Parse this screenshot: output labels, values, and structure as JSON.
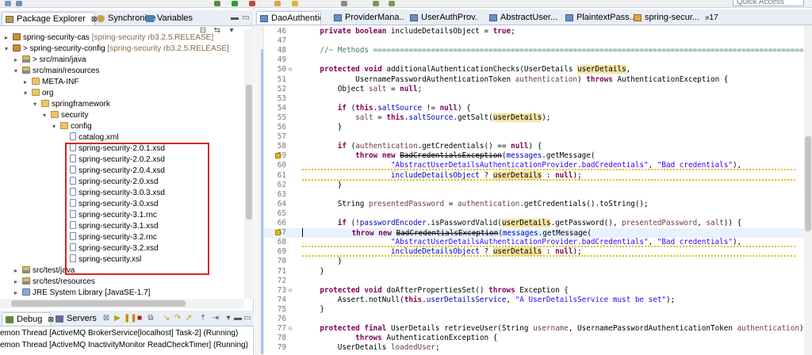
{
  "toolbar": {
    "quick_access_placeholder": "Quick Access"
  },
  "left_panel": {
    "tabs": [
      {
        "label": "Package Explorer",
        "close": "⊠"
      },
      {
        "label": "Synchronize"
      },
      {
        "label": "Variables"
      }
    ],
    "tree": [
      {
        "label": "spring-security-cas",
        "decor": " [spring-security rb3.2.5.RELEASE]",
        "icon": "project-icon",
        "twisty": "▸",
        "level": 0
      },
      {
        "label": "> spring-security-config",
        "decor": " [spring-security rb3.2.5.RELEASE]",
        "icon": "project-icon",
        "twisty": "▾",
        "level": 0
      },
      {
        "label": "> src/main/java",
        "decor": "",
        "icon": "source-folder-icon",
        "twisty": "▸",
        "level": 1
      },
      {
        "label": "src/main/resources",
        "decor": "",
        "icon": "source-folder-icon",
        "twisty": "▾",
        "level": 1
      },
      {
        "label": "META-INF",
        "decor": "",
        "icon": "folder-icon",
        "twisty": "▸",
        "level": 2
      },
      {
        "label": "org",
        "decor": "",
        "icon": "folder-icon",
        "twisty": "▾",
        "level": 2
      },
      {
        "label": "springframework",
        "decor": "",
        "icon": "folder-icon",
        "twisty": "▾",
        "level": 3
      },
      {
        "label": "security",
        "decor": "",
        "icon": "folder-icon",
        "twisty": "▾",
        "level": 4
      },
      {
        "label": "config",
        "decor": "",
        "icon": "folder-icon",
        "twisty": "▾",
        "level": 5
      },
      {
        "label": "catalog.xml",
        "decor": "",
        "icon": "file-icon",
        "twisty": "",
        "level": 6
      },
      {
        "label": "spring-security-2.0.1.xsd",
        "decor": "",
        "icon": "file-icon",
        "twisty": "",
        "level": 6
      },
      {
        "label": "spring-security-2.0.2.xsd",
        "decor": "",
        "icon": "file-icon",
        "twisty": "",
        "level": 6
      },
      {
        "label": "spring-security-2.0.4.xsd",
        "decor": "",
        "icon": "file-icon",
        "twisty": "",
        "level": 6
      },
      {
        "label": "spring-security-2.0.xsd",
        "decor": "",
        "icon": "file-icon",
        "twisty": "",
        "level": 6
      },
      {
        "label": "spring-security-3.0.3.xsd",
        "decor": "",
        "icon": "file-icon",
        "twisty": "",
        "level": 6
      },
      {
        "label": "spring-security-3.0.xsd",
        "decor": "",
        "icon": "file-icon",
        "twisty": "",
        "level": 6
      },
      {
        "label": "spring-security-3.1.rnc",
        "decor": "",
        "icon": "file-icon",
        "twisty": "",
        "level": 6
      },
      {
        "label": "spring-security-3.1.xsd",
        "decor": "",
        "icon": "file-icon",
        "twisty": "",
        "level": 6
      },
      {
        "label": "spring-security-3.2.rnc",
        "decor": "",
        "icon": "file-icon",
        "twisty": "",
        "level": 6
      },
      {
        "label": "spring-security-3.2.xsd",
        "decor": "",
        "icon": "file-icon",
        "twisty": "",
        "level": 6
      },
      {
        "label": "spring-security.xsl",
        "decor": "",
        "icon": "file-icon",
        "twisty": "",
        "level": 6
      },
      {
        "label": "src/test/java",
        "decor": "",
        "icon": "source-folder-icon",
        "twisty": "▸",
        "level": 1
      },
      {
        "label": "src/test/resources",
        "decor": "",
        "icon": "source-folder-icon",
        "twisty": "▸",
        "level": 1
      },
      {
        "label": "JRE System Library [JavaSE-1.7]",
        "decor": "",
        "icon": "library-icon",
        "twisty": "▸",
        "level": 1
      }
    ]
  },
  "bottom_panel": {
    "tabs": [
      {
        "label": "Debug",
        "close": "⊠"
      },
      {
        "label": "Servers"
      }
    ],
    "lines": [
      "emon Thread [ActiveMQ BrokerService[localhost] Task-2] (Running)",
      "emon Thread [ActiveMQ InactivityMonitor ReadCheckTimer] (Running)"
    ]
  },
  "editor": {
    "tabs": [
      {
        "label": "DaoAuthentic",
        "active": true
      },
      {
        "label": "ProviderMana..."
      },
      {
        "label": "UserAuthProv..."
      },
      {
        "label": "AbstractUser..."
      },
      {
        "label": "PlaintextPass..."
      },
      {
        "label": "spring-secur..."
      }
    ],
    "overflow_count": "»17",
    "lines": [
      {
        "n": "46",
        "segs": [
          [
            "t",
            "    "
          ],
          [
            "kw",
            "private boolean"
          ],
          [
            "t",
            " includeDetailsObject = "
          ],
          [
            "kw",
            "true"
          ],
          [
            "t",
            ";"
          ]
        ]
      },
      {
        "n": "47",
        "segs": []
      },
      {
        "n": "48",
        "segs": [
          [
            "t",
            "    "
          ],
          [
            "cm",
            "//~ Methods ========================================================================================================"
          ]
        ]
      },
      {
        "n": "49",
        "segs": []
      },
      {
        "n": "50",
        "fold": "⊖",
        "segs": [
          [
            "t",
            "    "
          ],
          [
            "kw",
            "protected void"
          ],
          [
            "t",
            " additionalAuthenticationChecks(UserDetails "
          ],
          [
            "occ",
            "userDetails"
          ],
          [
            "t",
            ","
          ]
        ]
      },
      {
        "n": "51",
        "segs": [
          [
            "t",
            "            UsernamePasswordAuthenticationToken "
          ],
          [
            "prm",
            "authentication"
          ],
          [
            "t",
            ") "
          ],
          [
            "kw",
            "throws"
          ],
          [
            "t",
            " AuthenticationException {"
          ]
        ]
      },
      {
        "n": "52",
        "segs": [
          [
            "t",
            "        Object "
          ],
          [
            "prm",
            "salt"
          ],
          [
            "t",
            " = "
          ],
          [
            "kw",
            "null"
          ],
          [
            "t",
            ";"
          ]
        ]
      },
      {
        "n": "53",
        "segs": []
      },
      {
        "n": "54",
        "segs": [
          [
            "t",
            "        "
          ],
          [
            "kw",
            "if"
          ],
          [
            "t",
            " ("
          ],
          [
            "kw",
            "this"
          ],
          [
            "t",
            "."
          ],
          [
            "fld",
            "saltSource"
          ],
          [
            "t",
            " != "
          ],
          [
            "kw",
            "null"
          ],
          [
            "t",
            ") {"
          ]
        ]
      },
      {
        "n": "55",
        "segs": [
          [
            "t",
            "            "
          ],
          [
            "prm",
            "salt"
          ],
          [
            "t",
            " = "
          ],
          [
            "kw",
            "this"
          ],
          [
            "t",
            "."
          ],
          [
            "fld",
            "saltSource"
          ],
          [
            "t",
            ".getSalt("
          ],
          [
            "occ",
            "userDetails"
          ],
          [
            "t",
            ");"
          ]
        ]
      },
      {
        "n": "56",
        "segs": [
          [
            "t",
            "        }"
          ]
        ]
      },
      {
        "n": "57",
        "segs": []
      },
      {
        "n": "58",
        "segs": [
          [
            "t",
            "        "
          ],
          [
            "kw",
            "if"
          ],
          [
            "t",
            " ("
          ],
          [
            "prm",
            "authentication"
          ],
          [
            "t",
            ".getCredentials() == "
          ],
          [
            "kw",
            "null"
          ],
          [
            "t",
            ") {"
          ]
        ]
      },
      {
        "n": "59",
        "marker": "warn",
        "segs": [
          [
            "t",
            "            "
          ],
          [
            "kw",
            "throw new"
          ],
          [
            "t",
            " "
          ],
          [
            "strike",
            "BadCredentialsException"
          ],
          [
            "t",
            "("
          ],
          [
            "fld",
            "messages"
          ],
          [
            "t",
            ".getMessage("
          ]
        ]
      },
      {
        "n": "60",
        "warn": true,
        "segs": [
          [
            "t",
            "                    "
          ],
          [
            "str",
            "\"AbstractUserDetailsAuthenticationProvider.badCredentials\""
          ],
          [
            "t",
            ", "
          ],
          [
            "str",
            "\"Bad credentials\""
          ],
          [
            "t",
            "),"
          ]
        ]
      },
      {
        "n": "61",
        "warn": true,
        "segs": [
          [
            "t",
            "                    "
          ],
          [
            "fld",
            "includeDetailsObject"
          ],
          [
            "t",
            " ? "
          ],
          [
            "occ",
            "userDetails"
          ],
          [
            "t",
            " : "
          ],
          [
            "kw",
            "null"
          ],
          [
            "t",
            ");"
          ]
        ]
      },
      {
        "n": "62",
        "segs": [
          [
            "t",
            "        }"
          ]
        ]
      },
      {
        "n": "63",
        "segs": []
      },
      {
        "n": "64",
        "segs": [
          [
            "t",
            "        String "
          ],
          [
            "prm",
            "presentedPassword"
          ],
          [
            "t",
            " = "
          ],
          [
            "prm",
            "authentication"
          ],
          [
            "t",
            ".getCredentials().toString();"
          ]
        ]
      },
      {
        "n": "65",
        "segs": []
      },
      {
        "n": "66",
        "segs": [
          [
            "t",
            "        "
          ],
          [
            "kw",
            "if"
          ],
          [
            "t",
            " (!"
          ],
          [
            "fld",
            "passwordEncoder"
          ],
          [
            "t",
            ".isPasswordValid("
          ],
          [
            "occ",
            "userDetails"
          ],
          [
            "t",
            ".getPassword(), "
          ],
          [
            "prm",
            "presentedPassword"
          ],
          [
            "t",
            ", "
          ],
          [
            "prm",
            "salt"
          ],
          [
            "t",
            ")) {"
          ]
        ]
      },
      {
        "n": "67",
        "marker": "warn",
        "current": true,
        "segs": [
          [
            "caret",
            ""
          ],
          [
            "t",
            "           "
          ],
          [
            "kw",
            "throw new"
          ],
          [
            "t",
            " "
          ],
          [
            "strike",
            "BadCredentialsException"
          ],
          [
            "t",
            "("
          ],
          [
            "fld",
            "messages"
          ],
          [
            "t",
            ".getMessage("
          ]
        ]
      },
      {
        "n": "68",
        "warn": true,
        "segs": [
          [
            "t",
            "                    "
          ],
          [
            "str",
            "\"AbstractUserDetailsAuthenticationProvider.badCredentials\""
          ],
          [
            "t",
            ", "
          ],
          [
            "str",
            "\"Bad credentials\""
          ],
          [
            "t",
            "),"
          ]
        ]
      },
      {
        "n": "69",
        "warn": true,
        "segs": [
          [
            "t",
            "                    "
          ],
          [
            "fld",
            "includeDetailsObject"
          ],
          [
            "t",
            " ? "
          ],
          [
            "occ",
            "userDetails"
          ],
          [
            "t",
            " : "
          ],
          [
            "kw",
            "null"
          ],
          [
            "t",
            ");"
          ]
        ]
      },
      {
        "n": "70",
        "segs": [
          [
            "t",
            "        }"
          ]
        ]
      },
      {
        "n": "71",
        "segs": [
          [
            "t",
            "    }"
          ]
        ]
      },
      {
        "n": "72",
        "segs": []
      },
      {
        "n": "73",
        "fold": "⊖",
        "segs": [
          [
            "t",
            "    "
          ],
          [
            "kw",
            "protected void"
          ],
          [
            "t",
            " doAfterPropertiesSet() "
          ],
          [
            "kw",
            "throws"
          ],
          [
            "t",
            " Exception {"
          ]
        ]
      },
      {
        "n": "74",
        "segs": [
          [
            "t",
            "        Assert.notNull("
          ],
          [
            "kw",
            "this"
          ],
          [
            "t",
            "."
          ],
          [
            "fld",
            "userDetailsService"
          ],
          [
            "t",
            ", "
          ],
          [
            "str",
            "\"A UserDetailsService must be set\""
          ],
          [
            "t",
            ");"
          ]
        ]
      },
      {
        "n": "75",
        "segs": [
          [
            "t",
            "    }"
          ]
        ]
      },
      {
        "n": "76",
        "segs": []
      },
      {
        "n": "77",
        "fold": "⊖",
        "segs": [
          [
            "t",
            "    "
          ],
          [
            "kw",
            "protected final"
          ],
          [
            "t",
            " UserDetails retrieveUser(String "
          ],
          [
            "prm",
            "username"
          ],
          [
            "t",
            ", UsernamePasswordAuthenticationToken "
          ],
          [
            "prm",
            "authentication"
          ],
          [
            "t",
            ")"
          ]
        ]
      },
      {
        "n": "78",
        "segs": [
          [
            "t",
            "            "
          ],
          [
            "kw",
            "throws"
          ],
          [
            "t",
            " AuthenticationException {"
          ]
        ]
      },
      {
        "n": "79",
        "segs": [
          [
            "t",
            "        UserDetails "
          ],
          [
            "prm",
            "loadedUser"
          ],
          [
            "t",
            ";"
          ]
        ]
      }
    ]
  },
  "colors": {
    "keyword": "#7f0055",
    "comment": "#3f7f5f",
    "string": "#2a00ff",
    "field": "#0000c0",
    "highlight_box": "#e02020",
    "occurrence": "#f4e3a6"
  }
}
